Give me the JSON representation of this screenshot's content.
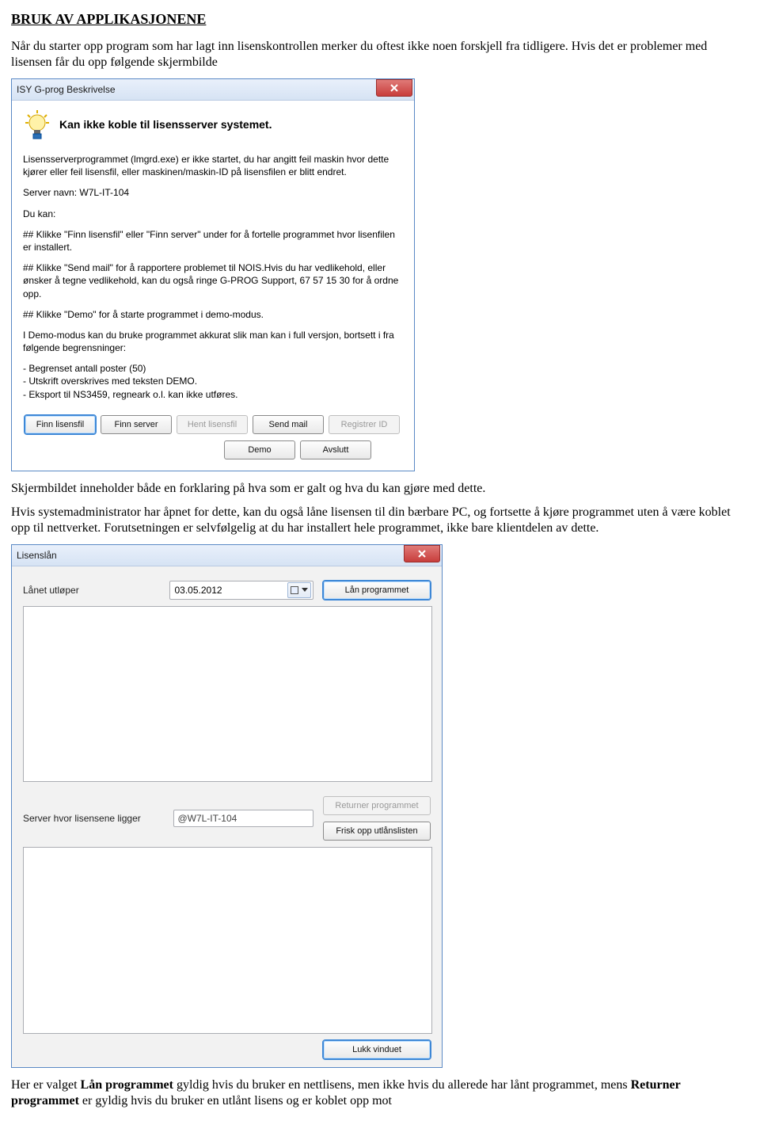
{
  "doc": {
    "heading": "BRUK AV APPLIKASJONENE",
    "p1": "Når du starter opp program som har lagt inn lisenskontrollen merker du oftest ikke noen forskjell fra tidligere. Hvis det er problemer med lisensen får du opp følgende skjermbilde",
    "p2": "Skjermbildet inneholder både en forklaring på hva som er galt og hva du kan gjøre med dette.",
    "p3": "Hvis systemadministrator har åpnet for dette, kan du også låne lisensen til din bærbare PC, og fortsette å kjøre programmet uten å være koblet opp til nettverket. Forutsetningen er selvfølgelig at du har installert hele programmet, ikke bare klientdelen av dette.",
    "p4a": "Her er valget ",
    "p4b": "Lån programmet",
    "p4c": " gyldig hvis du bruker en nettlisens, men ikke hvis du allerede har lånt programmet, mens ",
    "p4d": "Returner programmet",
    "p4e": " er gyldig hvis du bruker en utlånt lisens og er koblet opp mot"
  },
  "dlg1": {
    "title": "ISY G-prog Beskrivelse",
    "heading": "Kan ikke koble til lisensserver systemet.",
    "para1": "Lisensserverprogrammet (lmgrd.exe) er ikke startet, du har angitt feil maskin hvor dette kjører eller feil lisensfil, eller maskinen/maskin-ID på lisensfilen er blitt endret.",
    "server_line": "Server navn: W7L-IT-104",
    "du_kan": "Du kan:",
    "b1": "## Klikke \"Finn lisensfil\" eller \"Finn server\" under for å fortelle programmet hvor lisenfilen er installert.",
    "b2": "## Klikke \"Send mail\" for å rapportere problemet til NOIS.Hvis du har vedlikehold, eller ønsker å tegne vedlikehold, kan du også ringe G-PROG Support, 67 57 15 30 for å ordne opp.",
    "b3": "## Klikke \"Demo\" for å starte programmet i demo-modus.",
    "demo_head": "I Demo-modus kan du bruke programmet akkurat slik man kan i full versjon, bortsett i fra følgende begrensninger:",
    "d1": "- Begrenset antall poster (50)",
    "d2": "- Utskrift overskrives med teksten DEMO.",
    "d3": "- Eksport til NS3459, regneark o.l. kan ikke utføres.",
    "btn_finn_lisensfil": "Finn lisensfil",
    "btn_finn_server": "Finn server",
    "btn_hent_lisensfil": "Hent lisensfil",
    "btn_send_mail": "Send mail",
    "btn_registrer_id": "Registrer ID",
    "btn_demo": "Demo",
    "btn_avslutt": "Avslutt"
  },
  "dlg2": {
    "title": "Lisenslån",
    "lbl_lanet": "Lånet utløper",
    "date": "03.05.2012",
    "btn_lan": "Lån programmet",
    "lbl_server": "Server hvor lisensene ligger",
    "server_value": "@W7L-IT-104",
    "btn_returner": "Returner programmet",
    "btn_frisk": "Frisk opp utlånslisten",
    "btn_lukk": "Lukk vinduet"
  }
}
